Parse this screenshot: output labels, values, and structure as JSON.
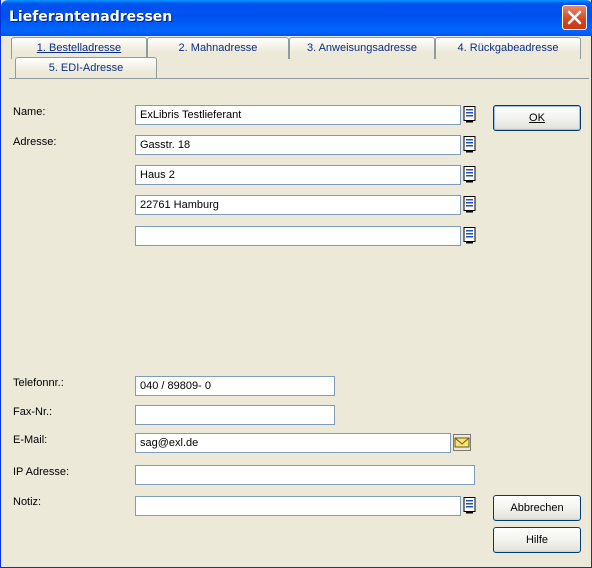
{
  "window": {
    "title": "Lieferantenadressen",
    "close_icon": "close-icon"
  },
  "tabs": [
    {
      "label": "1. Bestelladresse",
      "active": true
    },
    {
      "label": "2. Mahnadresse"
    },
    {
      "label": "3. Anweisungsadresse"
    },
    {
      "label": "4. Rückgabeadresse"
    },
    {
      "label": "5. EDI-Adresse"
    }
  ],
  "form": {
    "name_label": "Name:",
    "name_value": "ExLibris Testlieferant",
    "address_label": "Adresse:",
    "address_lines": [
      "Gasstr. 18",
      "Haus 2",
      "22761 Hamburg",
      ""
    ],
    "phone_label": "Telefonnr.:",
    "phone_value": "040 / 89809- 0",
    "fax_label": "Fax-Nr.:",
    "fax_value": "",
    "email_label": "E-Mail:",
    "email_value": "sag@exl.de",
    "ip_label": "IP Adresse:",
    "ip_value": "",
    "note_label": "Notiz:",
    "note_value": ""
  },
  "buttons": {
    "ok": "OK",
    "cancel": "Abbrechen",
    "help": "Hilfe"
  },
  "colors": {
    "titlebar": "#0054e3",
    "tab_text": "#0c2d83",
    "face": "#ece9d8"
  }
}
